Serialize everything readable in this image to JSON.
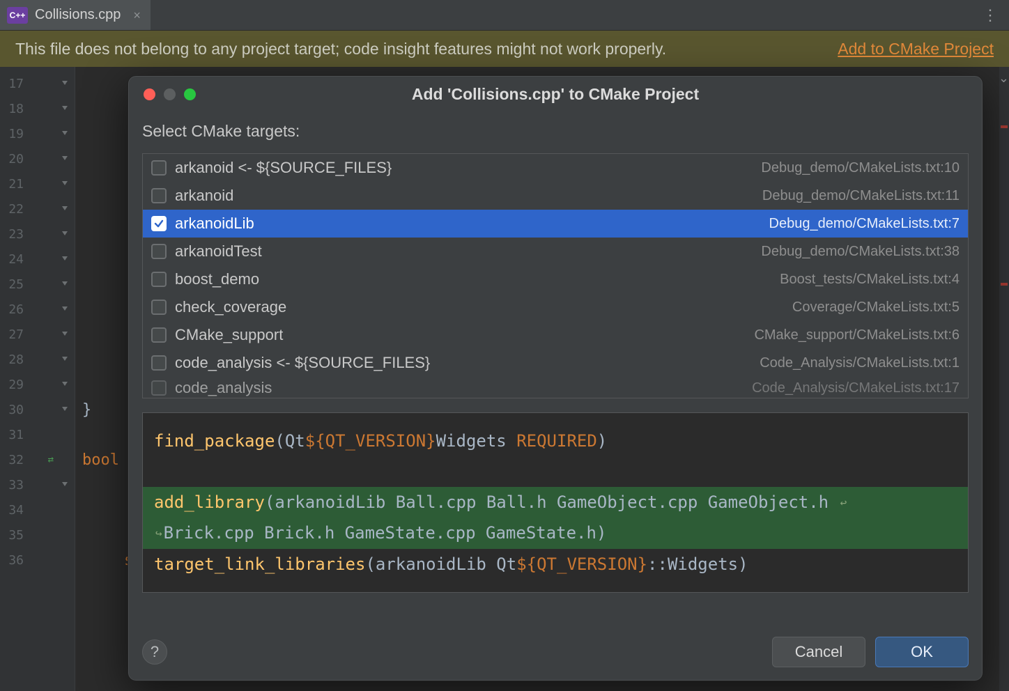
{
  "tab": {
    "filename": "Collisions.cpp"
  },
  "banner": {
    "message": "This file does not belong to any project target; code insight features might not work properly.",
    "action_label": "Add to CMake Project"
  },
  "editor": {
    "first_line_number": 17,
    "line_count": 20,
    "fragments": {
      "brace": "}",
      "bool_prefix": "bool",
      "switch_line": "switch (type) {"
    }
  },
  "dialog": {
    "title": "Add 'Collisions.cpp' to CMake Project",
    "select_label": "Select CMake targets:",
    "targets": [
      {
        "name": "arkanoid <- ${SOURCE_FILES}",
        "location": "Debug_demo/CMakeLists.txt:10",
        "checked": false,
        "selected": false
      },
      {
        "name": "arkanoid",
        "location": "Debug_demo/CMakeLists.txt:11",
        "checked": false,
        "selected": false
      },
      {
        "name": "arkanoidLib",
        "location": "Debug_demo/CMakeLists.txt:7",
        "checked": true,
        "selected": true
      },
      {
        "name": "arkanoidTest",
        "location": "Debug_demo/CMakeLists.txt:38",
        "checked": false,
        "selected": false
      },
      {
        "name": "boost_demo",
        "location": "Boost_tests/CMakeLists.txt:4",
        "checked": false,
        "selected": false
      },
      {
        "name": "check_coverage",
        "location": "Coverage/CMakeLists.txt:5",
        "checked": false,
        "selected": false
      },
      {
        "name": "CMake_support",
        "location": "CMake_support/CMakeLists.txt:6",
        "checked": false,
        "selected": false
      },
      {
        "name": "code_analysis <- ${SOURCE_FILES}",
        "location": "Code_Analysis/CMakeLists.txt:1",
        "checked": false,
        "selected": false
      },
      {
        "name": "code_analysis",
        "location": "Code_Analysis/CMakeLists.txt:17",
        "checked": false,
        "selected": false,
        "cut": true
      }
    ],
    "preview": {
      "line1": {
        "fn": "find_package",
        "open": "(",
        "args_a": "Qt",
        "macro": "${",
        "macro_in": "QT_VERSION",
        "macro_close": "}",
        "args_b": "Widgets ",
        "kw": "REQUIRED",
        "close": ")"
      },
      "line3a": {
        "fn": "add_library",
        "open": "(",
        "rest": "arkanoidLib Ball.cpp Ball.h GameObject.cpp GameObject.h "
      },
      "line3b": {
        "rest": "Brick.cpp Brick.h GameState.cpp GameState.h",
        "close": ")"
      },
      "line4": {
        "fn": "target_link_libraries",
        "open": "(",
        "args_a": "arkanoidLib Qt",
        "macro": "${",
        "macro_in": "QT_VERSION",
        "macro_close": "}",
        "args_b": "::Widgets",
        "close": ")"
      }
    },
    "buttons": {
      "cancel": "Cancel",
      "ok": "OK"
    }
  }
}
